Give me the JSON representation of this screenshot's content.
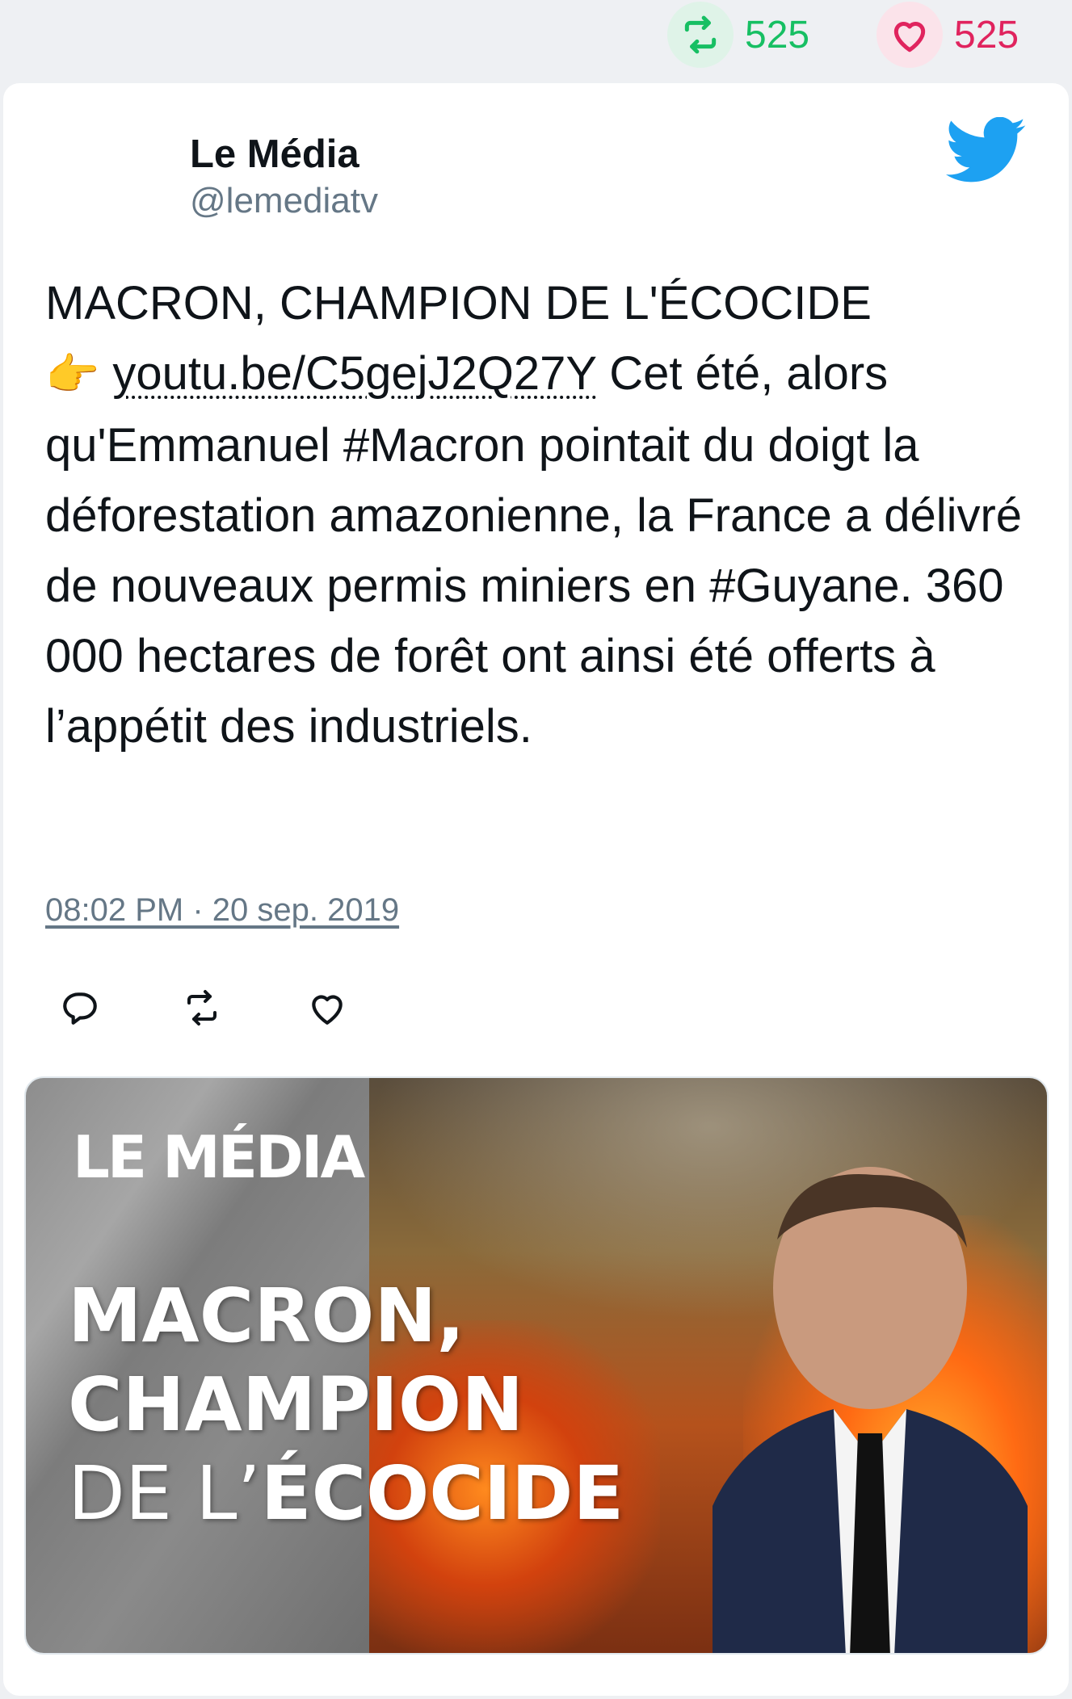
{
  "top_stats": {
    "retweet_count": "525",
    "like_count": "525"
  },
  "author": {
    "name": "Le Média",
    "handle": "@lemediatv"
  },
  "tweet": {
    "line1": "MACRON, CHAMPION DE L'ÉCOCIDE",
    "emoji": "👉",
    "link": "youtu.be/C5gejJ2Q27Y",
    "body": " Cet été, alors qu'Emmanuel #Macron pointait du doigt la déforestation amazonienne, la France a délivré de nouveaux permis miniers en #Guyane. 360 000 hectares de forêt ont ainsi été offerts à l’appétit des industriels."
  },
  "timestamp": "08:02 PM · 20 sep. 2019",
  "icons": {
    "retweet": "retweet-icon",
    "like": "heart-icon",
    "reply": "reply-icon",
    "brand": "twitter-bird-icon"
  },
  "media": {
    "logo_text": "LE MÉDIA",
    "headline_line1": "MACRON,",
    "headline_line2": "CHAMPION",
    "headline_line3a": "DE L’",
    "headline_line3b": "ÉCOCIDE"
  },
  "colors": {
    "retweet_green": "#17bf63",
    "like_red": "#e0245e",
    "twitter_blue": "#1da1f2",
    "muted": "#657786"
  }
}
